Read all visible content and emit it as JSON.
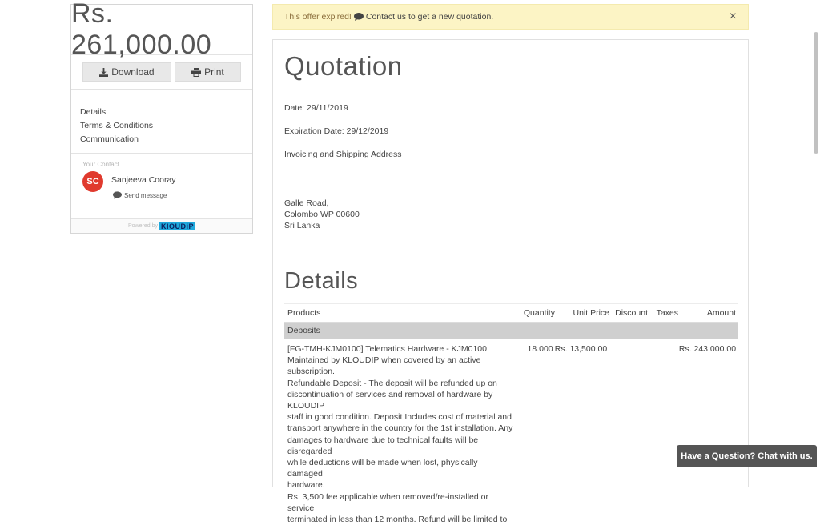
{
  "sidebar": {
    "total": "Rs. 261,000.00",
    "download_label": "Download",
    "print_label": "Print",
    "nav": [
      "Details",
      "Terms & Conditions",
      "Communication"
    ],
    "contact_label": "Your Contact",
    "contact_initials": "SC",
    "contact_name": "Sanjeeva Cooray",
    "send_message": "Send message",
    "powered_by": "Powered by",
    "brand": "KlOUDiP"
  },
  "alert": {
    "warning": "This offer expired!",
    "info": "Contact us to get a new quotation.",
    "close": "×"
  },
  "doc": {
    "title": "Quotation",
    "date": "Date: 29/11/2019",
    "expiration": "Expiration Date: 29/12/2019",
    "address_label": "Invoicing and Shipping Address",
    "address_lines": [
      "Galle Road,",
      "Colombo WP 00600",
      "Sri Lanka"
    ],
    "details_title": "Details",
    "columns": [
      "Products",
      "Quantity",
      "Unit Price",
      "Discount",
      "Taxes",
      "Amount"
    ],
    "section": "Deposits",
    "item": {
      "description_lines": [
        "[FG-TMH-KJM0100] Telematics Hardware - KJM0100",
        "Maintained by KLOUDIP when covered by an active subscription.",
        "Refundable Deposit - The deposit will be refunded up on",
        "discontinuation of services and removal of hardware by KLOUDIP",
        "staff in good condition. Deposit Includes cost of material and",
        "transport anywhere in the country for the 1st installation. Any",
        "damages to hardware due to technical faults will be disregarded",
        "while deductions will be made when lost, physically damaged",
        "hardware.",
        "Rs. 3,500 fee applicable when removed/re-installed or service",
        "terminated in less than 12 months. Refund will be limited to"
      ],
      "quantity": "18.000",
      "unit_price": "Rs. 13,500.00",
      "amount": "Rs. 243,000.00"
    }
  },
  "chat": {
    "label": "Have a Question? Chat with us."
  },
  "colors": {
    "alert_bg": "#fcf4c5",
    "brand": "#1fa8dc",
    "avatar": "#e03a2e"
  }
}
